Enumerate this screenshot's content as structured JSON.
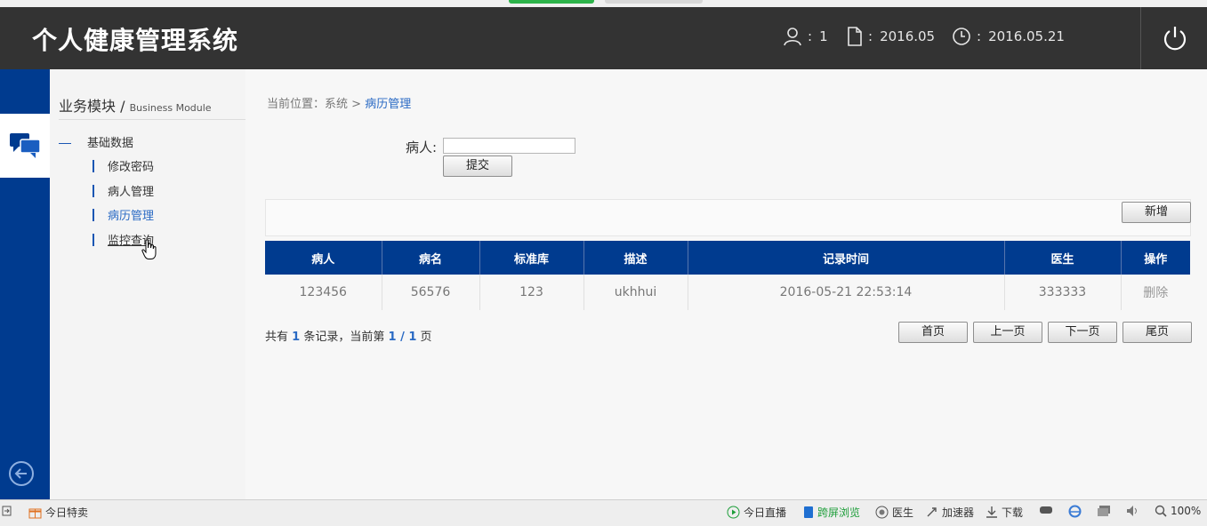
{
  "header": {
    "title": "个人健康管理系统",
    "user_count": "1",
    "date_month": "2016.05",
    "date_day": "2016.05.21",
    "colon": ":"
  },
  "sidebar": {
    "module_title": "业务模块",
    "module_sep": " / ",
    "module_subtitle": "Business Module",
    "group_label": "基础数据",
    "items": [
      {
        "label": "修改密码"
      },
      {
        "label": "病人管理"
      },
      {
        "label": "病历管理"
      },
      {
        "label": "监控查询"
      }
    ]
  },
  "breadcrumb": {
    "prefix": "当前位置：",
    "root": "系统",
    "sep": " > ",
    "current": "病历管理"
  },
  "search": {
    "label": "病人:",
    "value": "",
    "submit_label": "提交"
  },
  "toolbar": {
    "add_label": "新增"
  },
  "table": {
    "columns": [
      "病人",
      "病名",
      "标准库",
      "描述",
      "记录时间",
      "医生",
      "操作"
    ],
    "rows": [
      {
        "patient": "123456",
        "disease": "56576",
        "standard": "123",
        "desc": "ukhhui",
        "time": "2016-05-21 22:53:14",
        "doctor": "333333",
        "action": "删除"
      }
    ]
  },
  "pager": {
    "text_a": "共有",
    "total": "1",
    "text_b": "条记录，当前第",
    "page": "1 / 1",
    "text_c": "页",
    "first_label": "首页",
    "prev_label": "上一页",
    "next_label": "下一页",
    "last_label": "尾页"
  },
  "statusbar": {
    "deal_label": "今日特卖",
    "live_label": "今日直播",
    "cross_label": "跨屏浏览",
    "doctor_label": "医生",
    "accel_label": "加速器",
    "download_label": "下载",
    "zoom": "100%"
  },
  "colors": {
    "header_bg": "#333333",
    "primary_blue": "#003b8f",
    "link_blue": "#2a6ac4"
  }
}
